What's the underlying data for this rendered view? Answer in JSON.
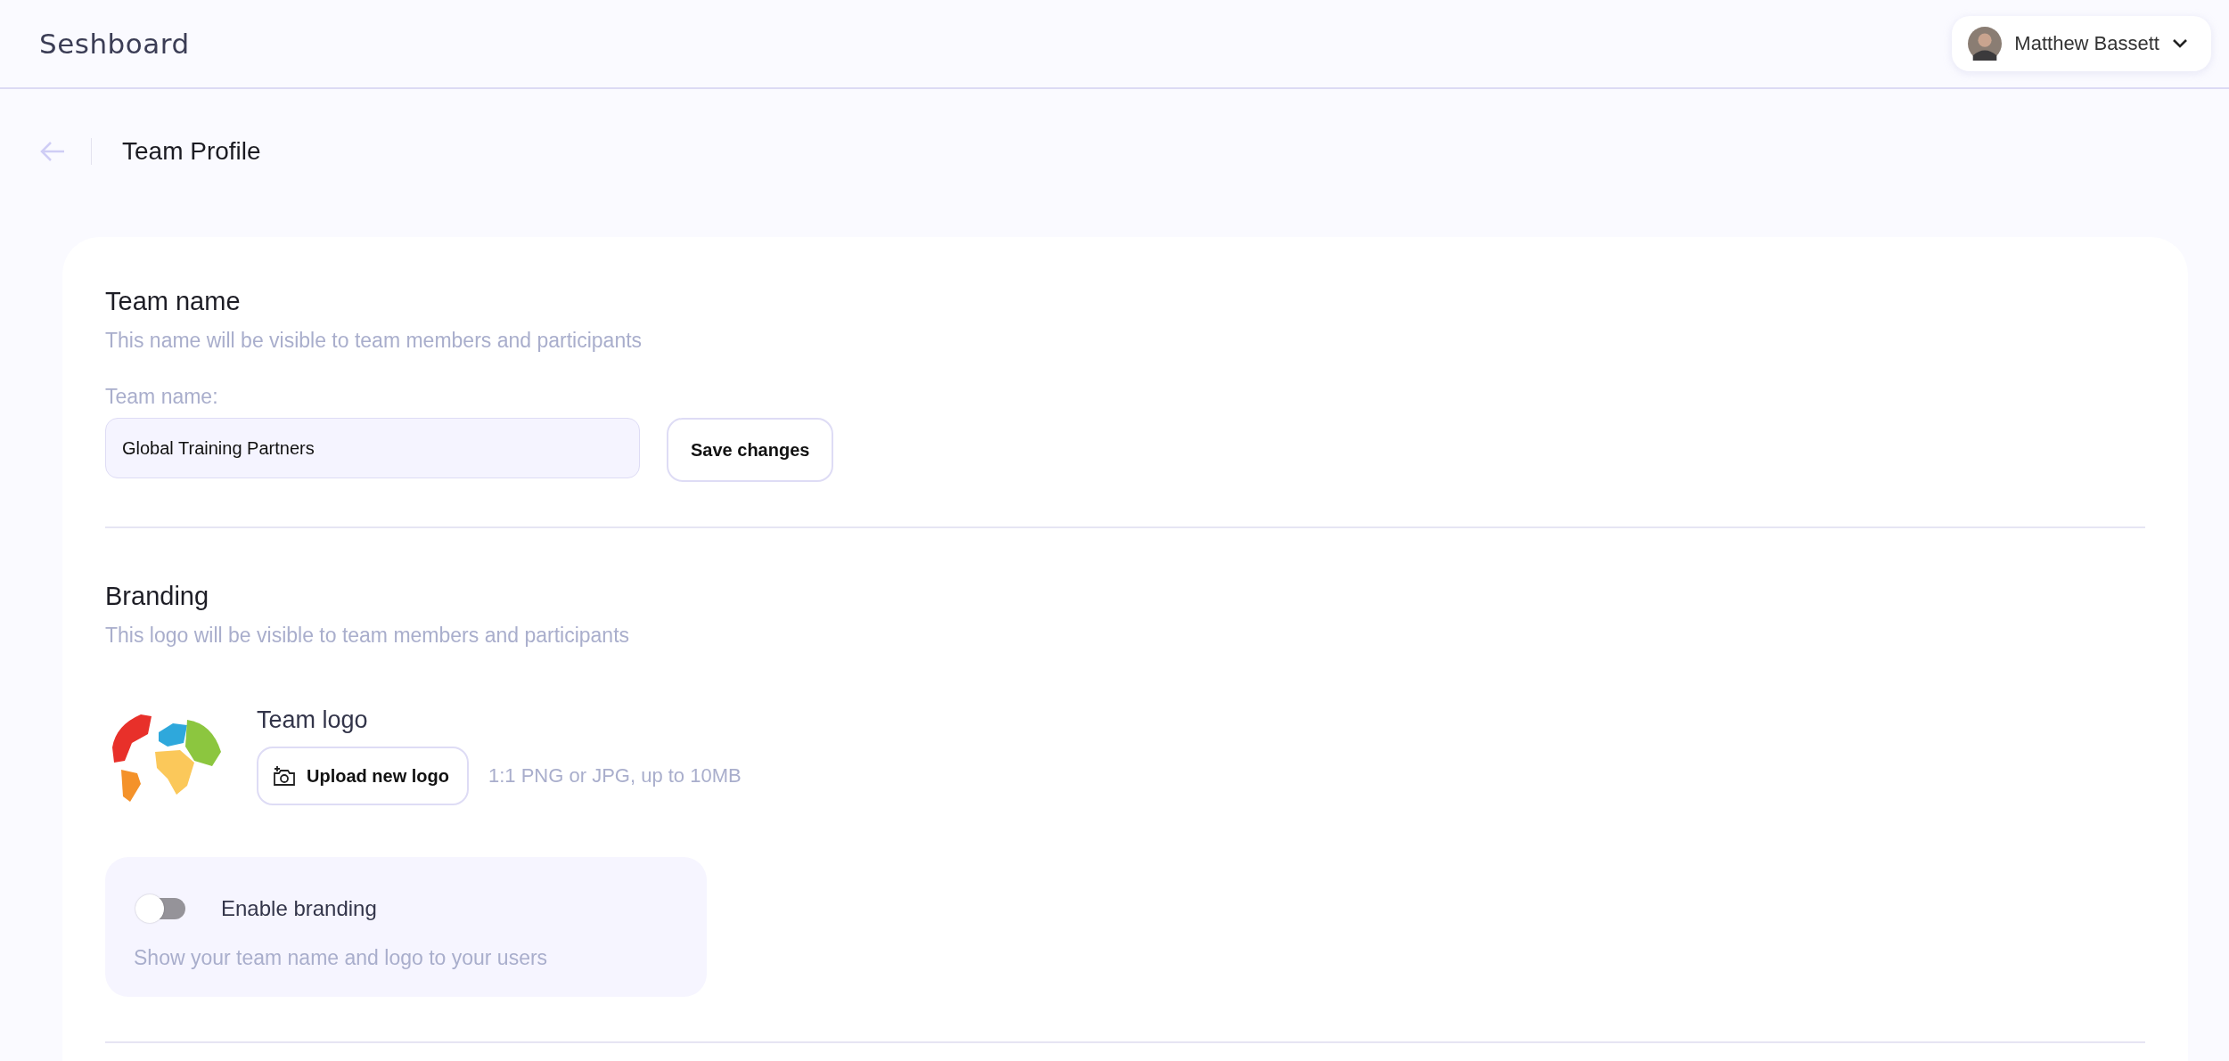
{
  "header": {
    "app_name": "Seshboard",
    "user": {
      "name": "Matthew Bassett"
    }
  },
  "page": {
    "title": "Team Profile"
  },
  "team_name_section": {
    "heading": "Team name",
    "description": "This name will be visible to team members and participants",
    "field_label": "Team name:",
    "value": "Global Training Partners",
    "save_button": "Save changes"
  },
  "branding_section": {
    "heading": "Branding",
    "description": "This logo will be visible to team members and participants",
    "logo_label": "Team logo",
    "upload_button": "Upload new logo",
    "upload_hint": "1:1 PNG or JPG, up to 10MB",
    "toggle": {
      "label": "Enable branding",
      "on": false,
      "description": "Show your team name and logo to your users"
    }
  }
}
